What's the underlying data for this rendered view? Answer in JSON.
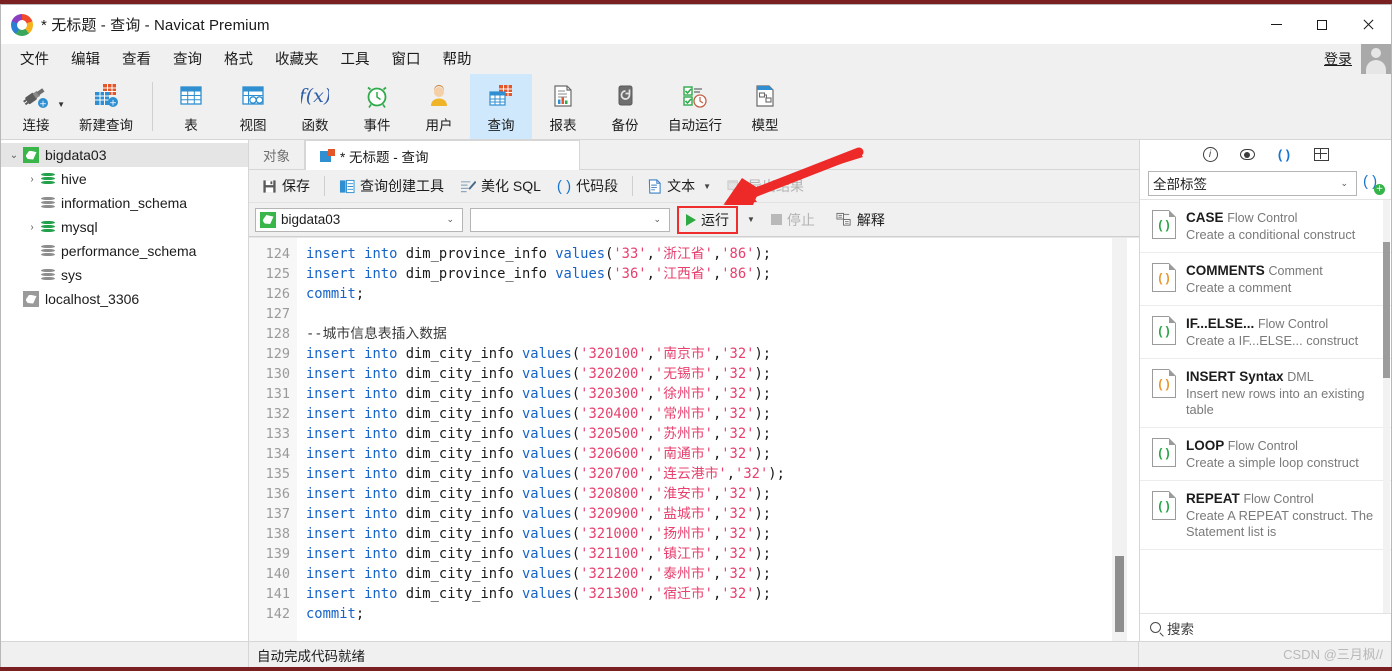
{
  "window": {
    "title": "* 无标题 - 查询 - Navicat Premium",
    "minimize_label": "—",
    "maximize_label": "□",
    "close_label": "✕"
  },
  "menubar": {
    "items": [
      "文件",
      "编辑",
      "查看",
      "查询",
      "格式",
      "收藏夹",
      "工具",
      "窗口",
      "帮助"
    ],
    "login_label": "登录"
  },
  "toolbar": {
    "items": [
      {
        "label": "连接",
        "icon": "connection-icon",
        "has_caret": true
      },
      {
        "label": "新建查询",
        "icon": "new-query-icon",
        "has_caret": false
      },
      {
        "label": "表",
        "icon": "table-icon",
        "has_caret": false
      },
      {
        "label": "视图",
        "icon": "view-icon",
        "has_caret": false
      },
      {
        "label": "函数",
        "icon": "function-icon",
        "has_caret": false
      },
      {
        "label": "事件",
        "icon": "event-clock-icon",
        "has_caret": false
      },
      {
        "label": "用户",
        "icon": "user-icon",
        "has_caret": false
      },
      {
        "label": "查询",
        "icon": "query-icon",
        "has_caret": false
      },
      {
        "label": "报表",
        "icon": "report-icon",
        "has_caret": false
      },
      {
        "label": "备份",
        "icon": "backup-icon",
        "has_caret": false
      },
      {
        "label": "自动运行",
        "icon": "automation-icon",
        "has_caret": false
      },
      {
        "label": "模型",
        "icon": "model-icon",
        "has_caret": false
      }
    ],
    "active_index": 7
  },
  "sidebar": {
    "nodes": [
      {
        "label": "bigdata03",
        "type": "connection",
        "level": 0,
        "twisty": "⌄",
        "selected": true,
        "color": "green"
      },
      {
        "label": "hive",
        "type": "database",
        "level": 1,
        "twisty": "›",
        "selected": false,
        "color": "green"
      },
      {
        "label": "information_schema",
        "type": "database",
        "level": 1,
        "twisty": "",
        "selected": false,
        "color": "grey"
      },
      {
        "label": "mysql",
        "type": "database",
        "level": 1,
        "twisty": "›",
        "selected": false,
        "color": "green"
      },
      {
        "label": "performance_schema",
        "type": "database",
        "level": 1,
        "twisty": "",
        "selected": false,
        "color": "grey"
      },
      {
        "label": "sys",
        "type": "database",
        "level": 1,
        "twisty": "",
        "selected": false,
        "color": "grey"
      },
      {
        "label": "localhost_3306",
        "type": "connection",
        "level": 0,
        "twisty": "",
        "selected": false,
        "color": "grey"
      }
    ]
  },
  "tabs": {
    "object_tab": "对象",
    "query_tab": "* 无标题 - 查询"
  },
  "query_toolbar": {
    "save": "保存",
    "query_builder": "查询创建工具",
    "beautify_sql": "美化 SQL",
    "code_snippet": "代码段",
    "text": "文本",
    "export_result": "导出结果"
  },
  "query_bar2": {
    "database_value": "bigdata03",
    "schema_value": "",
    "run": "运行",
    "stop": "停止",
    "explain": "解释"
  },
  "editor": {
    "first_line_number": 124,
    "lines": [
      {
        "n": 124,
        "tokens": [
          {
            "t": "insert",
            "c": "kw"
          },
          {
            "t": " ",
            "c": "pun"
          },
          {
            "t": "into",
            "c": "kw"
          },
          {
            "t": " dim_province_info ",
            "c": "pun"
          },
          {
            "t": "values",
            "c": "kw"
          },
          {
            "t": "(",
            "c": "pun"
          },
          {
            "t": "'33'",
            "c": "str"
          },
          {
            "t": ",",
            "c": "pun"
          },
          {
            "t": "'浙江省'",
            "c": "str"
          },
          {
            "t": ",",
            "c": "pun"
          },
          {
            "t": "'86'",
            "c": "str"
          },
          {
            "t": ");",
            "c": "pun"
          }
        ]
      },
      {
        "n": 125,
        "tokens": [
          {
            "t": "insert",
            "c": "kw"
          },
          {
            "t": " ",
            "c": "pun"
          },
          {
            "t": "into",
            "c": "kw"
          },
          {
            "t": " dim_province_info ",
            "c": "pun"
          },
          {
            "t": "values",
            "c": "kw"
          },
          {
            "t": "(",
            "c": "pun"
          },
          {
            "t": "'36'",
            "c": "str"
          },
          {
            "t": ",",
            "c": "pun"
          },
          {
            "t": "'江西省'",
            "c": "str"
          },
          {
            "t": ",",
            "c": "pun"
          },
          {
            "t": "'86'",
            "c": "str"
          },
          {
            "t": ");",
            "c": "pun"
          }
        ]
      },
      {
        "n": 126,
        "tokens": [
          {
            "t": "commit",
            "c": "kw"
          },
          {
            "t": ";",
            "c": "pun"
          }
        ]
      },
      {
        "n": 127,
        "tokens": []
      },
      {
        "n": 128,
        "tokens": [
          {
            "t": "--城市信息表插入数据",
            "c": "cmt"
          }
        ]
      },
      {
        "n": 129,
        "tokens": [
          {
            "t": "insert",
            "c": "kw"
          },
          {
            "t": " ",
            "c": "pun"
          },
          {
            "t": "into",
            "c": "kw"
          },
          {
            "t": " dim_city_info ",
            "c": "pun"
          },
          {
            "t": "values",
            "c": "kw"
          },
          {
            "t": "(",
            "c": "pun"
          },
          {
            "t": "'320100'",
            "c": "str"
          },
          {
            "t": ",",
            "c": "pun"
          },
          {
            "t": "'南京市'",
            "c": "str"
          },
          {
            "t": ",",
            "c": "pun"
          },
          {
            "t": "'32'",
            "c": "str"
          },
          {
            "t": ");",
            "c": "pun"
          }
        ]
      },
      {
        "n": 130,
        "tokens": [
          {
            "t": "insert",
            "c": "kw"
          },
          {
            "t": " ",
            "c": "pun"
          },
          {
            "t": "into",
            "c": "kw"
          },
          {
            "t": " dim_city_info ",
            "c": "pun"
          },
          {
            "t": "values",
            "c": "kw"
          },
          {
            "t": "(",
            "c": "pun"
          },
          {
            "t": "'320200'",
            "c": "str"
          },
          {
            "t": ",",
            "c": "pun"
          },
          {
            "t": "'无锡市'",
            "c": "str"
          },
          {
            "t": ",",
            "c": "pun"
          },
          {
            "t": "'32'",
            "c": "str"
          },
          {
            "t": ");",
            "c": "pun"
          }
        ]
      },
      {
        "n": 131,
        "tokens": [
          {
            "t": "insert",
            "c": "kw"
          },
          {
            "t": " ",
            "c": "pun"
          },
          {
            "t": "into",
            "c": "kw"
          },
          {
            "t": " dim_city_info ",
            "c": "pun"
          },
          {
            "t": "values",
            "c": "kw"
          },
          {
            "t": "(",
            "c": "pun"
          },
          {
            "t": "'320300'",
            "c": "str"
          },
          {
            "t": ",",
            "c": "pun"
          },
          {
            "t": "'徐州市'",
            "c": "str"
          },
          {
            "t": ",",
            "c": "pun"
          },
          {
            "t": "'32'",
            "c": "str"
          },
          {
            "t": ");",
            "c": "pun"
          }
        ]
      },
      {
        "n": 132,
        "tokens": [
          {
            "t": "insert",
            "c": "kw"
          },
          {
            "t": " ",
            "c": "pun"
          },
          {
            "t": "into",
            "c": "kw"
          },
          {
            "t": " dim_city_info ",
            "c": "pun"
          },
          {
            "t": "values",
            "c": "kw"
          },
          {
            "t": "(",
            "c": "pun"
          },
          {
            "t": "'320400'",
            "c": "str"
          },
          {
            "t": ",",
            "c": "pun"
          },
          {
            "t": "'常州市'",
            "c": "str"
          },
          {
            "t": ",",
            "c": "pun"
          },
          {
            "t": "'32'",
            "c": "str"
          },
          {
            "t": ");",
            "c": "pun"
          }
        ]
      },
      {
        "n": 133,
        "tokens": [
          {
            "t": "insert",
            "c": "kw"
          },
          {
            "t": " ",
            "c": "pun"
          },
          {
            "t": "into",
            "c": "kw"
          },
          {
            "t": " dim_city_info ",
            "c": "pun"
          },
          {
            "t": "values",
            "c": "kw"
          },
          {
            "t": "(",
            "c": "pun"
          },
          {
            "t": "'320500'",
            "c": "str"
          },
          {
            "t": ",",
            "c": "pun"
          },
          {
            "t": "'苏州市'",
            "c": "str"
          },
          {
            "t": ",",
            "c": "pun"
          },
          {
            "t": "'32'",
            "c": "str"
          },
          {
            "t": ");",
            "c": "pun"
          }
        ]
      },
      {
        "n": 134,
        "tokens": [
          {
            "t": "insert",
            "c": "kw"
          },
          {
            "t": " ",
            "c": "pun"
          },
          {
            "t": "into",
            "c": "kw"
          },
          {
            "t": " dim_city_info ",
            "c": "pun"
          },
          {
            "t": "values",
            "c": "kw"
          },
          {
            "t": "(",
            "c": "pun"
          },
          {
            "t": "'320600'",
            "c": "str"
          },
          {
            "t": ",",
            "c": "pun"
          },
          {
            "t": "'南通市'",
            "c": "str"
          },
          {
            "t": ",",
            "c": "pun"
          },
          {
            "t": "'32'",
            "c": "str"
          },
          {
            "t": ");",
            "c": "pun"
          }
        ]
      },
      {
        "n": 135,
        "tokens": [
          {
            "t": "insert",
            "c": "kw"
          },
          {
            "t": " ",
            "c": "pun"
          },
          {
            "t": "into",
            "c": "kw"
          },
          {
            "t": " dim_city_info ",
            "c": "pun"
          },
          {
            "t": "values",
            "c": "kw"
          },
          {
            "t": "(",
            "c": "pun"
          },
          {
            "t": "'320700'",
            "c": "str"
          },
          {
            "t": ",",
            "c": "pun"
          },
          {
            "t": "'连云港市'",
            "c": "str"
          },
          {
            "t": ",",
            "c": "pun"
          },
          {
            "t": "'32'",
            "c": "str"
          },
          {
            "t": ");",
            "c": "pun"
          }
        ]
      },
      {
        "n": 136,
        "tokens": [
          {
            "t": "insert",
            "c": "kw"
          },
          {
            "t": " ",
            "c": "pun"
          },
          {
            "t": "into",
            "c": "kw"
          },
          {
            "t": " dim_city_info ",
            "c": "pun"
          },
          {
            "t": "values",
            "c": "kw"
          },
          {
            "t": "(",
            "c": "pun"
          },
          {
            "t": "'320800'",
            "c": "str"
          },
          {
            "t": ",",
            "c": "pun"
          },
          {
            "t": "'淮安市'",
            "c": "str"
          },
          {
            "t": ",",
            "c": "pun"
          },
          {
            "t": "'32'",
            "c": "str"
          },
          {
            "t": ");",
            "c": "pun"
          }
        ]
      },
      {
        "n": 137,
        "tokens": [
          {
            "t": "insert",
            "c": "kw"
          },
          {
            "t": " ",
            "c": "pun"
          },
          {
            "t": "into",
            "c": "kw"
          },
          {
            "t": " dim_city_info ",
            "c": "pun"
          },
          {
            "t": "values",
            "c": "kw"
          },
          {
            "t": "(",
            "c": "pun"
          },
          {
            "t": "'320900'",
            "c": "str"
          },
          {
            "t": ",",
            "c": "pun"
          },
          {
            "t": "'盐城市'",
            "c": "str"
          },
          {
            "t": ",",
            "c": "pun"
          },
          {
            "t": "'32'",
            "c": "str"
          },
          {
            "t": ");",
            "c": "pun"
          }
        ]
      },
      {
        "n": 138,
        "tokens": [
          {
            "t": "insert",
            "c": "kw"
          },
          {
            "t": " ",
            "c": "pun"
          },
          {
            "t": "into",
            "c": "kw"
          },
          {
            "t": " dim_city_info ",
            "c": "pun"
          },
          {
            "t": "values",
            "c": "kw"
          },
          {
            "t": "(",
            "c": "pun"
          },
          {
            "t": "'321000'",
            "c": "str"
          },
          {
            "t": ",",
            "c": "pun"
          },
          {
            "t": "'扬州市'",
            "c": "str"
          },
          {
            "t": ",",
            "c": "pun"
          },
          {
            "t": "'32'",
            "c": "str"
          },
          {
            "t": ");",
            "c": "pun"
          }
        ]
      },
      {
        "n": 139,
        "tokens": [
          {
            "t": "insert",
            "c": "kw"
          },
          {
            "t": " ",
            "c": "pun"
          },
          {
            "t": "into",
            "c": "kw"
          },
          {
            "t": " dim_city_info ",
            "c": "pun"
          },
          {
            "t": "values",
            "c": "kw"
          },
          {
            "t": "(",
            "c": "pun"
          },
          {
            "t": "'321100'",
            "c": "str"
          },
          {
            "t": ",",
            "c": "pun"
          },
          {
            "t": "'镇江市'",
            "c": "str"
          },
          {
            "t": ",",
            "c": "pun"
          },
          {
            "t": "'32'",
            "c": "str"
          },
          {
            "t": ");",
            "c": "pun"
          }
        ]
      },
      {
        "n": 140,
        "tokens": [
          {
            "t": "insert",
            "c": "kw"
          },
          {
            "t": " ",
            "c": "pun"
          },
          {
            "t": "into",
            "c": "kw"
          },
          {
            "t": " dim_city_info ",
            "c": "pun"
          },
          {
            "t": "values",
            "c": "kw"
          },
          {
            "t": "(",
            "c": "pun"
          },
          {
            "t": "'321200'",
            "c": "str"
          },
          {
            "t": ",",
            "c": "pun"
          },
          {
            "t": "'泰州市'",
            "c": "str"
          },
          {
            "t": ",",
            "c": "pun"
          },
          {
            "t": "'32'",
            "c": "str"
          },
          {
            "t": ");",
            "c": "pun"
          }
        ]
      },
      {
        "n": 141,
        "tokens": [
          {
            "t": "insert",
            "c": "kw"
          },
          {
            "t": " ",
            "c": "pun"
          },
          {
            "t": "into",
            "c": "kw"
          },
          {
            "t": " dim_city_info ",
            "c": "pun"
          },
          {
            "t": "values",
            "c": "kw"
          },
          {
            "t": "(",
            "c": "pun"
          },
          {
            "t": "'321300'",
            "c": "str"
          },
          {
            "t": ",",
            "c": "pun"
          },
          {
            "t": "'宿迁市'",
            "c": "str"
          },
          {
            "t": ",",
            "c": "pun"
          },
          {
            "t": "'32'",
            "c": "str"
          },
          {
            "t": ");",
            "c": "pun"
          }
        ]
      },
      {
        "n": 142,
        "tokens": [
          {
            "t": "commit",
            "c": "kw"
          },
          {
            "t": ";",
            "c": "pun"
          }
        ]
      }
    ]
  },
  "right_panel": {
    "icons": [
      "info-icon",
      "eye-icon",
      "parentheses-icon",
      "grid-icon"
    ],
    "filter_value": "全部标签",
    "add_snippet_icon": "add-snippet-icon",
    "snippets": [
      {
        "name": "CASE",
        "category": "Flow Control",
        "desc": "Create a conditional construct",
        "color": "green"
      },
      {
        "name": "COMMENTS",
        "category": "Comment",
        "desc": "Create a comment",
        "color": "orange"
      },
      {
        "name": "IF...ELSE...",
        "category": "Flow Control",
        "desc": "Create a IF...ELSE... construct",
        "color": "green"
      },
      {
        "name": "INSERT Syntax",
        "category": "DML",
        "desc": "Insert new rows into an existing table",
        "color": "orange"
      },
      {
        "name": "LOOP",
        "category": "Flow Control",
        "desc": "Create a simple loop construct",
        "color": "green"
      },
      {
        "name": "REPEAT",
        "category": "Flow Control",
        "desc": "Create A REPEAT construct. The Statement list is",
        "color": "green"
      }
    ],
    "search_placeholder": "搜索"
  },
  "statusbar": {
    "message": "自动完成代码就绪"
  },
  "watermark": {
    "text": "CSDN @三月枫//"
  },
  "colors": {
    "accent_blue": "#1675d1",
    "highlight_tab": "#cfe8fb",
    "run_highlight_border": "#ef2d2d",
    "arrow_red": "#ee2a28",
    "keyword": "#1763c7",
    "string": "#e8406f"
  }
}
